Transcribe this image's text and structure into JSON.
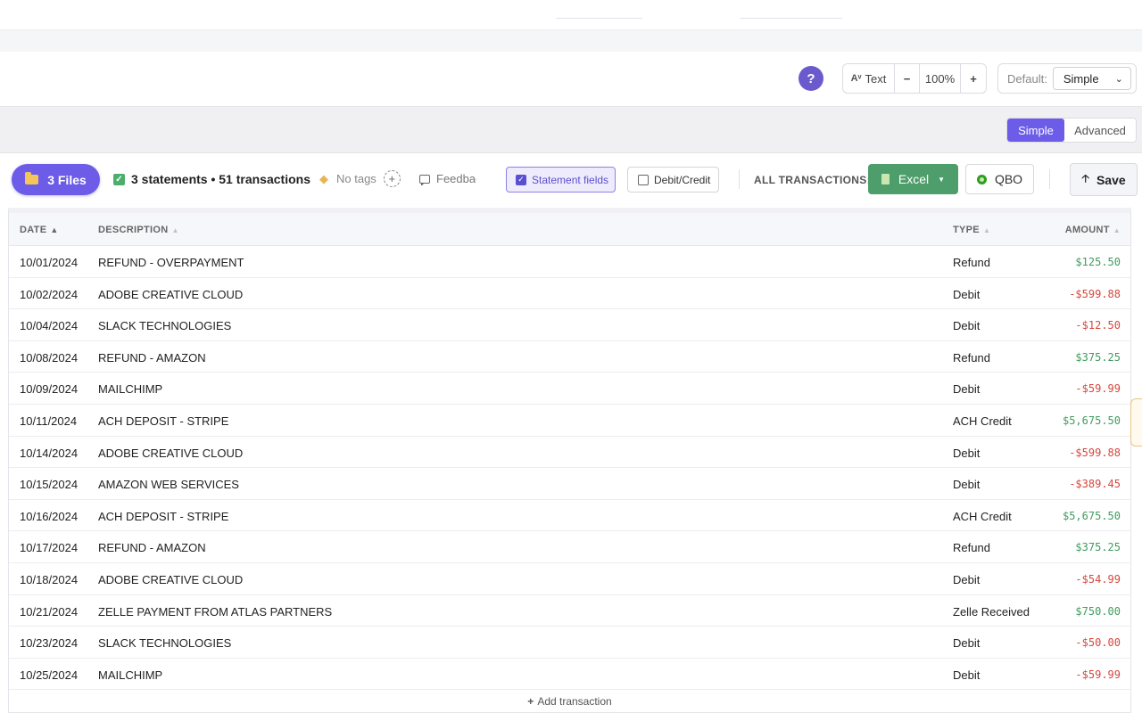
{
  "toolbar": {
    "help_label": "?",
    "text_label": "Text",
    "text_icon_glyph": "Aᵛ",
    "zoom_minus": "−",
    "zoom_value": "100%",
    "zoom_plus": "+",
    "default_label": "Default:",
    "default_value": "Simple"
  },
  "mode": {
    "simple": "Simple",
    "advanced": "Advanced",
    "selected": "Simple"
  },
  "actions": {
    "files_label": "3 Files",
    "statement_summary": "3 statements • 51 transactions",
    "tags_label": "No tags",
    "feedback_label": "Feedbac",
    "statement_fields_label": "Statement fields",
    "statement_fields_checked": true,
    "debit_credit_label": "Debit/Credit",
    "debit_credit_checked": false,
    "all_transactions_label": "ALL TRANSACTIONS:",
    "excel_label": "Excel",
    "qbo_label": "QBO",
    "save_label": "Save"
  },
  "table": {
    "headers": {
      "date": "DATE",
      "description": "DESCRIPTION",
      "type": "TYPE",
      "amount": "AMOUNT"
    },
    "rows": [
      {
        "date": "10/01/2024",
        "description": "REFUND - OVERPAYMENT",
        "type": "Refund",
        "amount": "$125.50",
        "sign": "pos"
      },
      {
        "date": "10/02/2024",
        "description": "ADOBE CREATIVE CLOUD",
        "type": "Debit",
        "amount": "-$599.88",
        "sign": "neg"
      },
      {
        "date": "10/04/2024",
        "description": "SLACK TECHNOLOGIES",
        "type": "Debit",
        "amount": "-$12.50",
        "sign": "neg"
      },
      {
        "date": "10/08/2024",
        "description": "REFUND - AMAZON",
        "type": "Refund",
        "amount": "$375.25",
        "sign": "pos"
      },
      {
        "date": "10/09/2024",
        "description": "MAILCHIMP",
        "type": "Debit",
        "amount": "-$59.99",
        "sign": "neg"
      },
      {
        "date": "10/11/2024",
        "description": "ACH DEPOSIT - STRIPE",
        "type": "ACH Credit",
        "amount": "$5,675.50",
        "sign": "pos"
      },
      {
        "date": "10/14/2024",
        "description": "ADOBE CREATIVE CLOUD",
        "type": "Debit",
        "amount": "-$599.88",
        "sign": "neg"
      },
      {
        "date": "10/15/2024",
        "description": "AMAZON WEB SERVICES",
        "type": "Debit",
        "amount": "-$389.45",
        "sign": "neg"
      },
      {
        "date": "10/16/2024",
        "description": "ACH DEPOSIT - STRIPE",
        "type": "ACH Credit",
        "amount": "$5,675.50",
        "sign": "pos"
      },
      {
        "date": "10/17/2024",
        "description": "REFUND - AMAZON",
        "type": "Refund",
        "amount": "$375.25",
        "sign": "pos"
      },
      {
        "date": "10/18/2024",
        "description": "ADOBE CREATIVE CLOUD",
        "type": "Debit",
        "amount": "-$54.99",
        "sign": "neg"
      },
      {
        "date": "10/21/2024",
        "description": "ZELLE PAYMENT FROM ATLAS PARTNERS",
        "type": "Zelle Received",
        "amount": "$750.00",
        "sign": "pos"
      },
      {
        "date": "10/23/2024",
        "description": "SLACK TECHNOLOGIES",
        "type": "Debit",
        "amount": "-$50.00",
        "sign": "neg"
      },
      {
        "date": "10/25/2024",
        "description": "MAILCHIMP",
        "type": "Debit",
        "amount": "-$59.99",
        "sign": "neg"
      }
    ],
    "add_label": "Add transaction"
  },
  "colors": {
    "accent": "#6c5ce7",
    "positive": "#3f9c5e",
    "negative": "#d6473d",
    "excel": "#4d9e6a"
  }
}
